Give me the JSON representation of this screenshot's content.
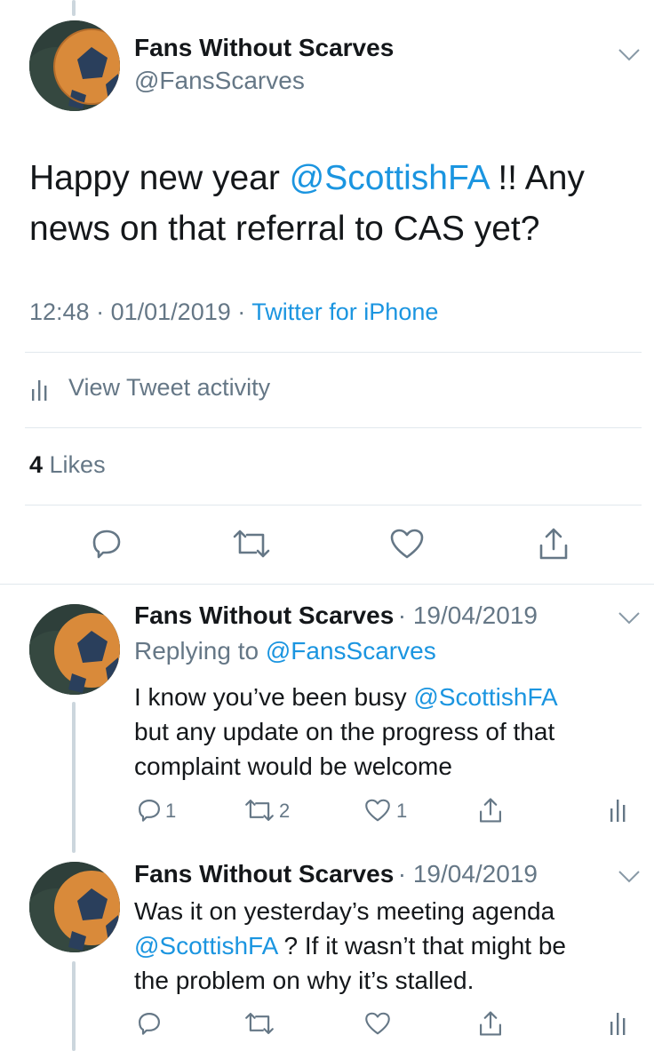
{
  "main_tweet": {
    "author_name": "Fans Without Scarves",
    "author_handle": "@FansScarves",
    "text_line1_a": "Happy new year ",
    "text_line1_mention": "@ScottishFA",
    "text_line1_b": " !! Any",
    "text_line2": "news on that referral to CAS yet?",
    "time": "12:48",
    "date": "01/01/2019",
    "sep": "·",
    "source": "Twitter for iPhone",
    "activity_label": "View Tweet activity",
    "likes_count": "4",
    "likes_label": " Likes"
  },
  "replies": [
    {
      "author_name": "Fans Without Scarves",
      "date": "· 19/04/2019",
      "replying_prefix": "Replying to ",
      "replying_handle": "@FansScarves",
      "line1_a": "I know you’ve been busy ",
      "line1_mention": "@ScottishFA",
      "line2": "but any update on the progress of that",
      "line3": "complaint would be welcome",
      "reply_count": "1",
      "retweet_count": "2",
      "like_count": "1"
    },
    {
      "author_name": "Fans Without Scarves",
      "date": "· 19/04/2019",
      "line1": "Was it on yesterday’s meeting agenda",
      "line2_mention": "@ScottishFA",
      "line2_b": " ? If it wasn’t that might be",
      "line3": "the problem on why it’s stalled."
    }
  ],
  "colors": {
    "link": "#1b95e0",
    "secondary_text": "#657786",
    "primary_text": "#14171a",
    "divider": "#e1e8ed"
  }
}
